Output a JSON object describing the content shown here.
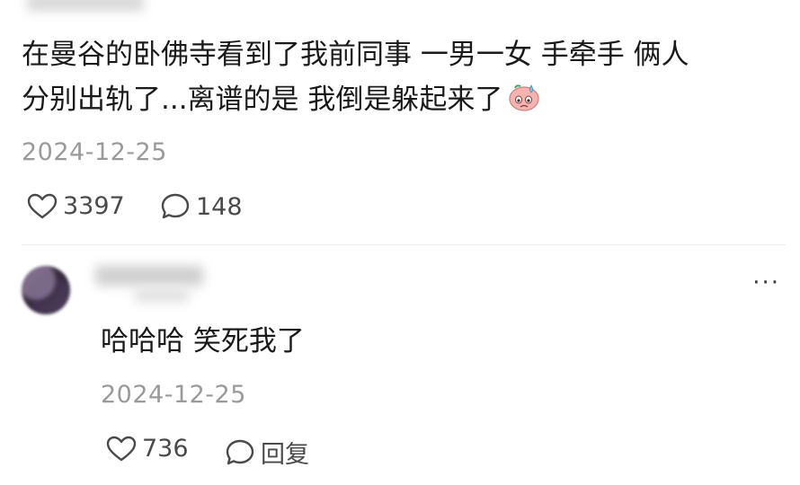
{
  "post": {
    "line1": "在曼谷的卧佛寺看到了我前同事 一男一女 手牵手 俩人",
    "line2": "分别出轨了...离谱的是 我倒是躲起来了",
    "date": "2024-12-25",
    "likes": "3397",
    "comments": "148"
  },
  "reply": {
    "text": "哈哈哈 笑死我了",
    "date": "2024-12-25",
    "likes": "736",
    "reply_label": "回复"
  },
  "more_label": "···",
  "icons": {
    "emoji": "sweating-face-emoji-icon",
    "like": "heart-icon",
    "comment": "comment-bubble-icon",
    "more": "more-dots-icon"
  },
  "colors": {
    "text": "#1a1a1a",
    "meta": "#9a9a9a",
    "icon": "#4a4a4a",
    "emoji": "#f2a3a3"
  }
}
